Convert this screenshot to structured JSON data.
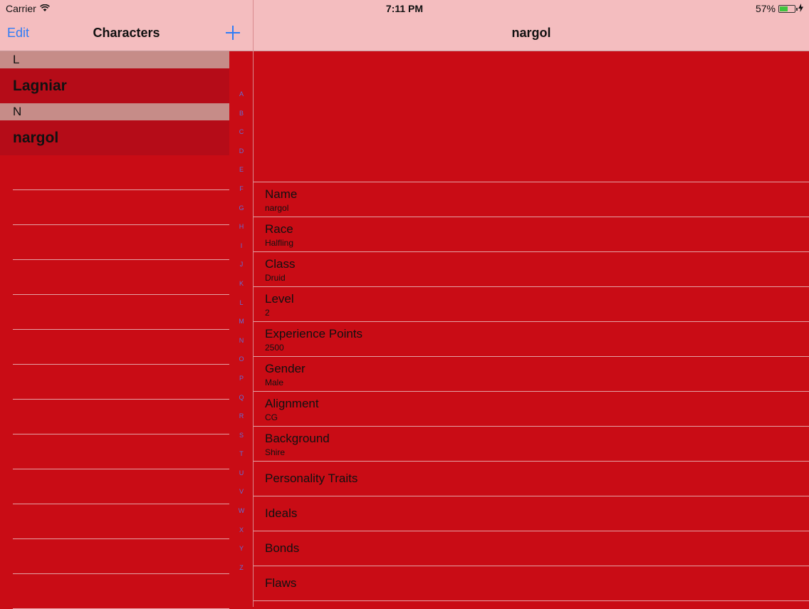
{
  "status": {
    "carrier": "Carrier",
    "time": "7:11 PM",
    "battery_percent": "57%",
    "battery_level": 0.57
  },
  "left_nav": {
    "edit_label": "Edit",
    "title": "Characters",
    "add_icon": "plus-icon"
  },
  "right_nav": {
    "title": "nargol"
  },
  "sections": [
    {
      "letter": "L",
      "characters": [
        "Lagniar"
      ]
    },
    {
      "letter": "N",
      "characters": [
        "nargol"
      ]
    }
  ],
  "index_letters": [
    "A",
    "B",
    "C",
    "D",
    "E",
    "F",
    "G",
    "H",
    "I",
    "J",
    "K",
    "L",
    "M",
    "N",
    "O",
    "P",
    "Q",
    "R",
    "S",
    "T",
    "U",
    "V",
    "W",
    "X",
    "Y",
    "Z"
  ],
  "details": [
    {
      "label": "Name",
      "value": "nargol"
    },
    {
      "label": "Race",
      "value": "Halfling"
    },
    {
      "label": "Class",
      "value": "Druid"
    },
    {
      "label": "Level",
      "value": "2"
    },
    {
      "label": "Experience Points",
      "value": "2500"
    },
    {
      "label": "Gender",
      "value": "Male"
    },
    {
      "label": "Alignment",
      "value": "CG"
    },
    {
      "label": "Background",
      "value": "Shire"
    },
    {
      "label": "Personality Traits",
      "value": ""
    },
    {
      "label": "Ideals",
      "value": ""
    },
    {
      "label": "Bonds",
      "value": ""
    },
    {
      "label": "Flaws",
      "value": ""
    }
  ],
  "colors": {
    "accent": "#2f7cf6",
    "background": "#c90c15",
    "bar": "#f4bdbf"
  }
}
